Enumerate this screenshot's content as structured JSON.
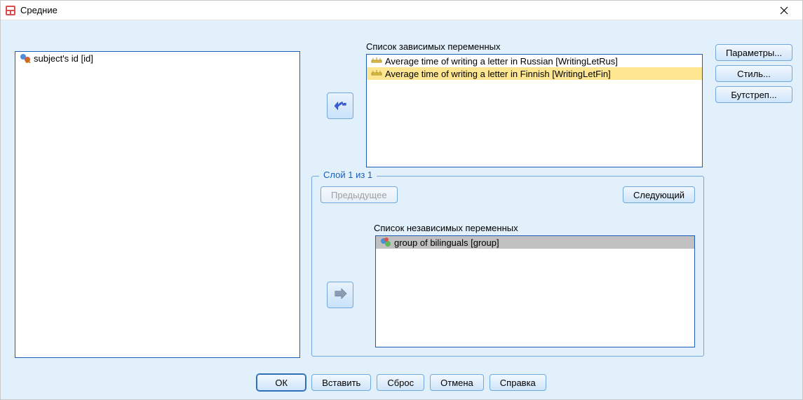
{
  "window": {
    "title": "Средние"
  },
  "source_list": {
    "items": [
      {
        "label": "subject's id [id]",
        "icon": "nominal"
      }
    ]
  },
  "dependent": {
    "label": "Список зависимых переменных",
    "items": [
      {
        "label": "Average time of writing a letter in Russian [WritingLetRus]",
        "icon": "scale",
        "selected": false
      },
      {
        "label": "Average time of writing a letter in Finnish [WritingLetFin]",
        "icon": "scale",
        "selected": true
      }
    ]
  },
  "layer": {
    "legend": "Слой 1 из 1",
    "prev": "Предыдущее",
    "next": "Следующий",
    "independent_label": "Список независимых переменных",
    "items": [
      {
        "label": "group of bilinguals [group]",
        "icon": "nominal",
        "selected": true
      }
    ]
  },
  "right_buttons": {
    "parameters": "Параметры...",
    "style": "Стиль...",
    "bootstrap": "Бутстреп..."
  },
  "bottom_buttons": {
    "ok": "ОК",
    "paste": "Вставить",
    "reset": "Сброс",
    "cancel": "Отмена",
    "help": "Справка"
  }
}
